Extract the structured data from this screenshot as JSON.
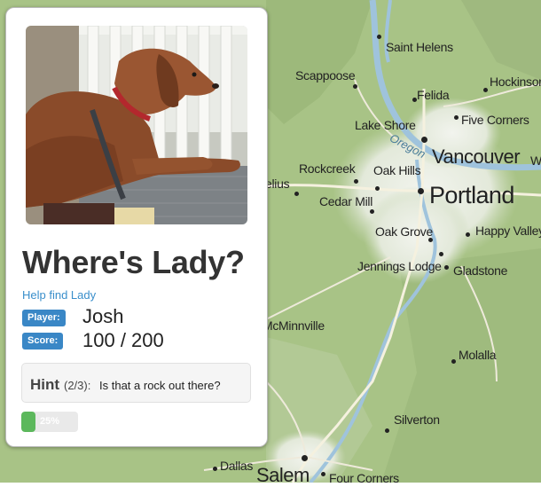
{
  "panel": {
    "title": "Where's Lady?",
    "help_link": "Help find Lady",
    "player_label": "Player:",
    "player_name": "Josh",
    "score_label": "Score:",
    "score_value": "100 / 200",
    "hint_label": "Hint",
    "hint_count": "(2/3):",
    "hint_text": "Is that a rock out there?",
    "progress_percent": 25,
    "progress_text": "25%"
  },
  "map": {
    "labels": {
      "saint_helens": "Saint Helens",
      "scappoose": "Scappoose",
      "hockinson": "Hockinson",
      "felida": "Felida",
      "lake_shore": "Lake Shore",
      "five_corners": "Five Corners",
      "vancouver": "Vancouver",
      "oregon_river": "Oregon",
      "w_edge": "W",
      "rockcreek": "Rockcreek",
      "oak_hills": "Oak Hills",
      "elius": "elius",
      "portland": "Portland",
      "cedar_mill": "Cedar Mill",
      "oak_grove": "Oak Grove",
      "happy_valley": "Happy Valley",
      "jennings_lodge": "Jennings Lodge",
      "gladstone": "Gladstone",
      "mcminnville": "McMinnville",
      "molalla": "Molalla",
      "silverton": "Silverton",
      "dallas": "Dallas",
      "salem": "Salem",
      "four_corners": "Four Corners"
    }
  },
  "colors": {
    "map_green": "#a9c48a",
    "urban": "#eef0ea",
    "water": "#9fc3dc",
    "badge_blue": "#3a87c6",
    "link_blue": "#3a8fcb",
    "progress_green": "#5cb85c"
  }
}
